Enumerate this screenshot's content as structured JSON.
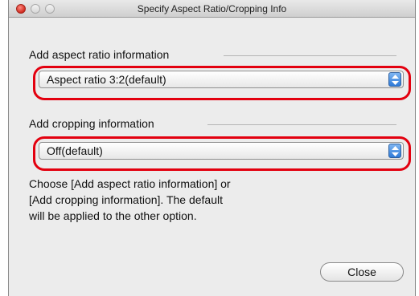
{
  "window": {
    "title": "Specify Aspect Ratio/Cropping Info"
  },
  "aspect_group": {
    "label": "Add aspect ratio information",
    "selected_value": "Aspect ratio 3:2(default)"
  },
  "cropping_group": {
    "label": "Add cropping information",
    "selected_value": "Off(default)"
  },
  "hint": {
    "line1": "Choose [Add aspect ratio information] or",
    "line2": "[Add cropping information]. The default",
    "line3": "will be applied to the other option."
  },
  "buttons": {
    "close_label": "Close"
  },
  "colors": {
    "highlight": "#e3000f",
    "popup_arrow_accent": "#2f7ad8"
  }
}
